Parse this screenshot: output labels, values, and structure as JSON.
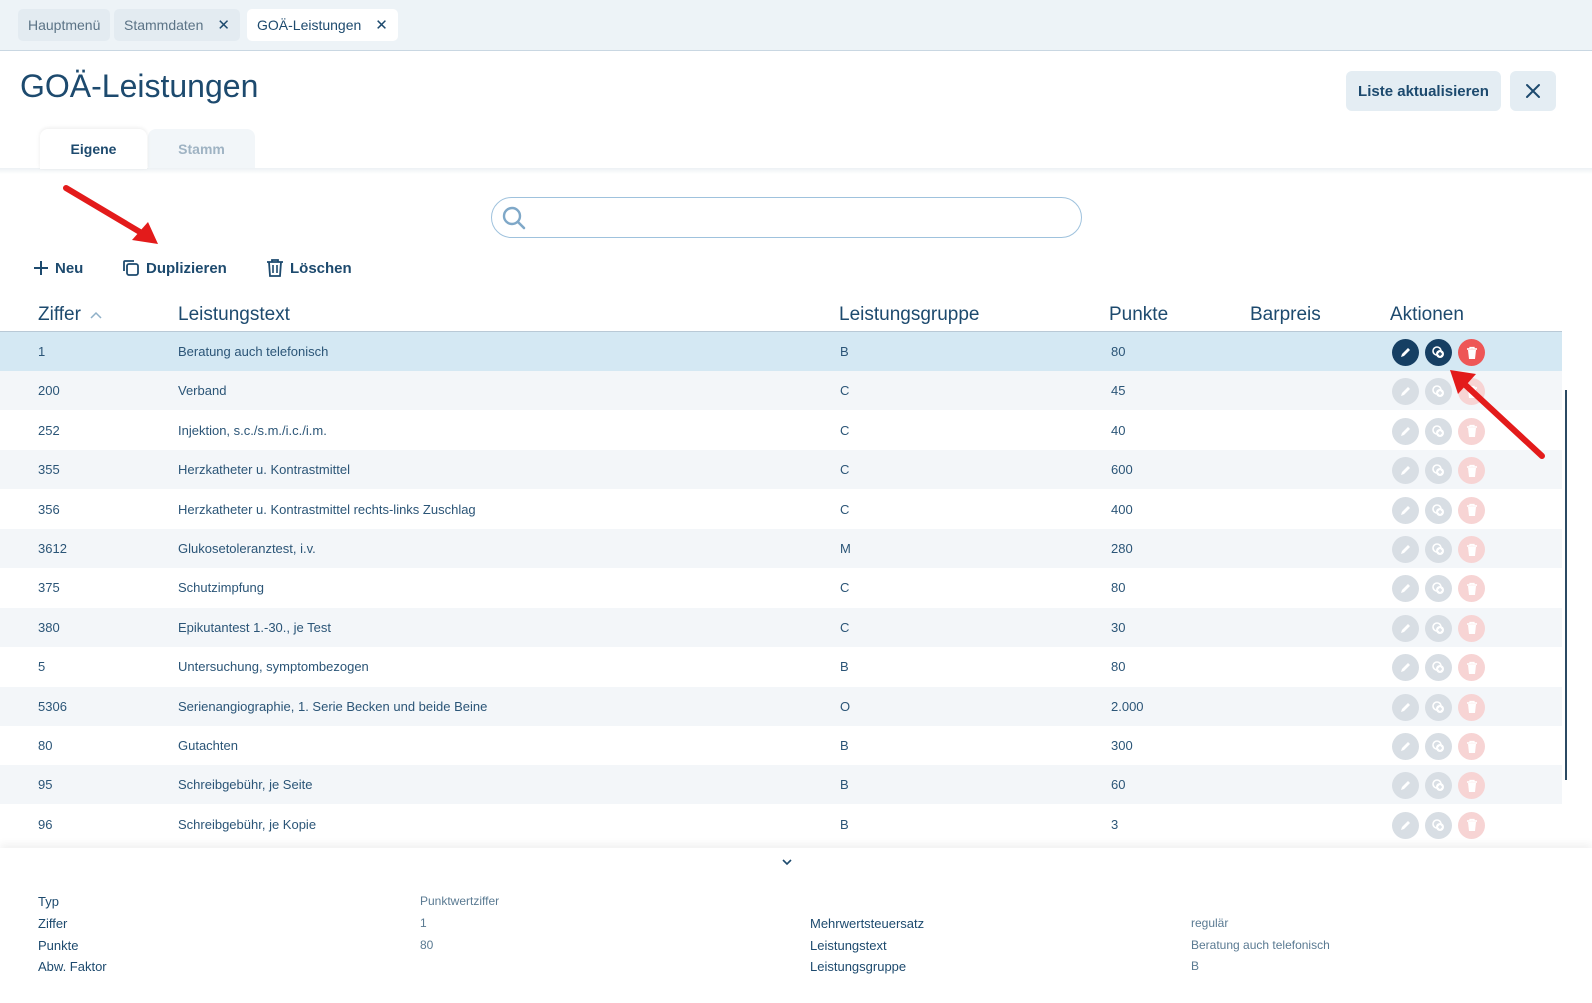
{
  "tabs": [
    {
      "label": "Hauptmenü",
      "closable": false,
      "active": false
    },
    {
      "label": "Stammdaten",
      "closable": true,
      "active": false
    },
    {
      "label": "GOÄ-Leistungen",
      "closable": true,
      "active": true
    }
  ],
  "page": {
    "title": "GOÄ-Leistungen",
    "refresh_label": "Liste aktualisieren"
  },
  "subtabs": {
    "own": "Eigene",
    "master": "Stamm"
  },
  "search": {
    "value": "",
    "placeholder": ""
  },
  "toolbar": {
    "new_label": "Neu",
    "duplicate_label": "Duplizieren",
    "delete_label": "Löschen"
  },
  "table": {
    "headers": {
      "ziffer": "Ziffer",
      "text": "Leistungstext",
      "group": "Leistungsgruppe",
      "points": "Punkte",
      "price": "Barpreis",
      "actions": "Aktionen"
    },
    "rows": [
      {
        "ziffer": "1",
        "text": "Beratung auch telefonisch",
        "group": "B",
        "points": "80",
        "price": ""
      },
      {
        "ziffer": "200",
        "text": "Verband",
        "group": "C",
        "points": "45",
        "price": ""
      },
      {
        "ziffer": "252",
        "text": "Injektion, s.c./s.m./i.c./i.m.",
        "group": "C",
        "points": "40",
        "price": ""
      },
      {
        "ziffer": "355",
        "text": "Herzkatheter u. Kontrastmittel",
        "group": "C",
        "points": "600",
        "price": ""
      },
      {
        "ziffer": "356",
        "text": "Herzkatheter u. Kontrastmittel rechts-links Zuschlag",
        "group": "C",
        "points": "400",
        "price": ""
      },
      {
        "ziffer": "3612",
        "text": "Glukosetoleranztest, i.v.",
        "group": "M",
        "points": "280",
        "price": ""
      },
      {
        "ziffer": "375",
        "text": "Schutzimpfung",
        "group": "C",
        "points": "80",
        "price": ""
      },
      {
        "ziffer": "380",
        "text": "Epikutantest 1.-30., je Test",
        "group": "C",
        "points": "30",
        "price": ""
      },
      {
        "ziffer": "5",
        "text": "Untersuchung, symptombezogen",
        "group": "B",
        "points": "80",
        "price": ""
      },
      {
        "ziffer": "5306",
        "text": "Serienangiographie, 1. Serie Becken und beide Beine",
        "group": "O",
        "points": "2.000",
        "price": ""
      },
      {
        "ziffer": "80",
        "text": "Gutachten",
        "group": "B",
        "points": "300",
        "price": ""
      },
      {
        "ziffer": "95",
        "text": "Schreibgebühr, je Seite",
        "group": "B",
        "points": "60",
        "price": ""
      },
      {
        "ziffer": "96",
        "text": "Schreibgebühr, je Kopie",
        "group": "B",
        "points": "3",
        "price": ""
      }
    ]
  },
  "detail": {
    "left": [
      {
        "label": "Typ",
        "value": "Punktwertziffer"
      },
      {
        "label": "Ziffer",
        "value": "1"
      },
      {
        "label": "Punkte",
        "value": "80"
      },
      {
        "label": "Abw. Faktor",
        "value": ""
      }
    ],
    "right": [
      {
        "label": "Mehrwertsteuersatz",
        "value": "regulär"
      },
      {
        "label": "Leistungstext",
        "value": "Beratung auch telefonisch"
      },
      {
        "label": "Leistungsgruppe",
        "value": "B"
      }
    ]
  },
  "colors": {
    "primary": "#1d4a6e",
    "selected_row": "#d4e8f3",
    "delete": "#ee5656",
    "annotation_arrow": "#e31b1b"
  }
}
